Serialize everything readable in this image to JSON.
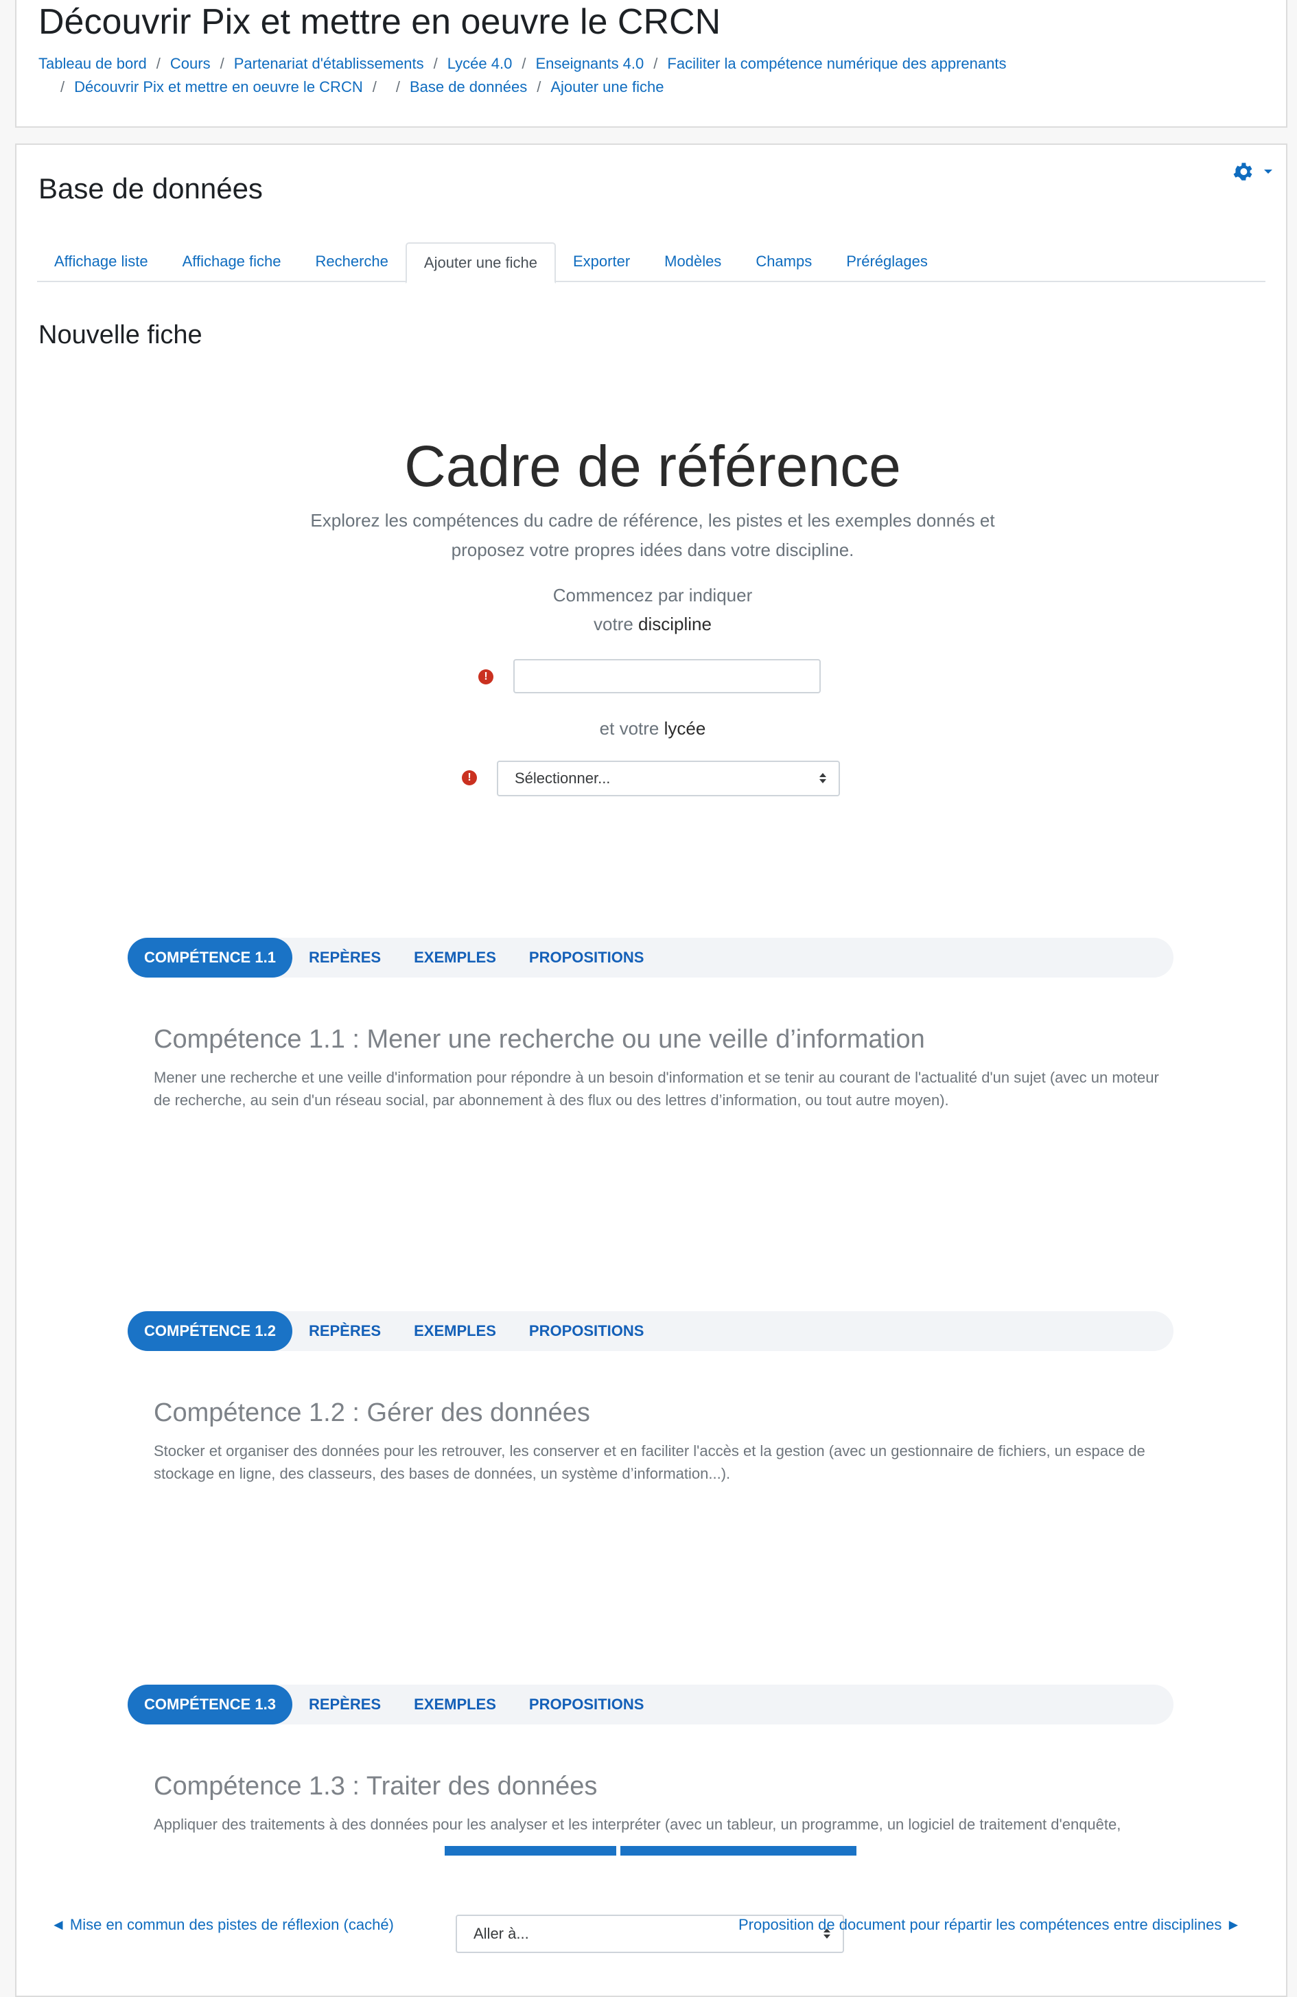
{
  "header": {
    "course_title": "Découvrir Pix et mettre en oeuvre le CRCN",
    "breadcrumb_row1": [
      "Tableau de bord",
      "Cours",
      "Partenariat d'établissements",
      "Lycée 4.0",
      "Enseignants 4.0",
      "Faciliter la compétence numérique des apprenants"
    ],
    "breadcrumb_row2": [
      "Découvrir Pix et mettre en oeuvre le CRCN",
      "",
      "Base de données",
      "Ajouter une fiche"
    ]
  },
  "main": {
    "title": "Base de données",
    "tabs": [
      "Affichage liste",
      "Affichage fiche",
      "Recherche",
      "Ajouter une fiche",
      "Exporter",
      "Modèles",
      "Champs",
      "Préréglages"
    ],
    "active_tab": "Ajouter une fiche",
    "new_entry_heading": "Nouvelle fiche"
  },
  "form": {
    "hero_title": "Cadre de référence",
    "intro_line1": "Explorez les compétences du cadre de référence, les pistes et les exemples donnés et",
    "intro_line2": "proposez votre propres idées dans votre discipline.",
    "discipline_prompt_line1": "Commencez par indiquer",
    "discipline_prompt_prefix": "votre ",
    "discipline_prompt_bold": "discipline",
    "discipline_value": "",
    "lycee_prompt_prefix": "et votre ",
    "lycee_prompt_bold": "lycée",
    "lycee_select_value": "Sélectionner...",
    "required_icon": "!"
  },
  "competences": [
    {
      "tabs": [
        "COMPÉTENCE 1.1",
        "REPÈRES",
        "EXEMPLES",
        "PROPOSITIONS"
      ],
      "title": "Compétence 1.1 : Mener une recherche ou une veille d’information",
      "desc": "Mener une recherche et une veille d'information pour répondre à un besoin d'information et se tenir au courant de l'actualité d'un sujet (avec un moteur de recherche, au sein d'un réseau social, par abonnement à des flux ou des lettres d’information, ou tout autre moyen)."
    },
    {
      "tabs": [
        "COMPÉTENCE 1.2",
        "REPÈRES",
        "EXEMPLES",
        "PROPOSITIONS"
      ],
      "title": "Compétence 1.2 : Gérer des données",
      "desc": "Stocker et organiser des données pour les retrouver, les conserver et en faciliter l'accès et la gestion (avec un gestionnaire de fichiers, un espace de stockage en ligne, des classeurs, des bases de données, un système d’information...)."
    },
    {
      "tabs": [
        "COMPÉTENCE 1.3",
        "REPÈRES",
        "EXEMPLES",
        "PROPOSITIONS"
      ],
      "title": "Compétence 1.3 : Traiter des données",
      "desc": "Appliquer des traitements à des données pour les analyser et les interpréter (avec un tableur, un programme, un logiciel de traitement d'enquête,"
    }
  ],
  "footer": {
    "prev_link": "◄ Mise en commun des pistes de réflexion (caché)",
    "jump_select": "Aller à...",
    "next_link": "Proposition de document pour répartir les compétences entre disciplines ►"
  },
  "colors": {
    "link": "#0f6cbf",
    "active_pill": "#1a73c6",
    "error": "#ca3120"
  }
}
